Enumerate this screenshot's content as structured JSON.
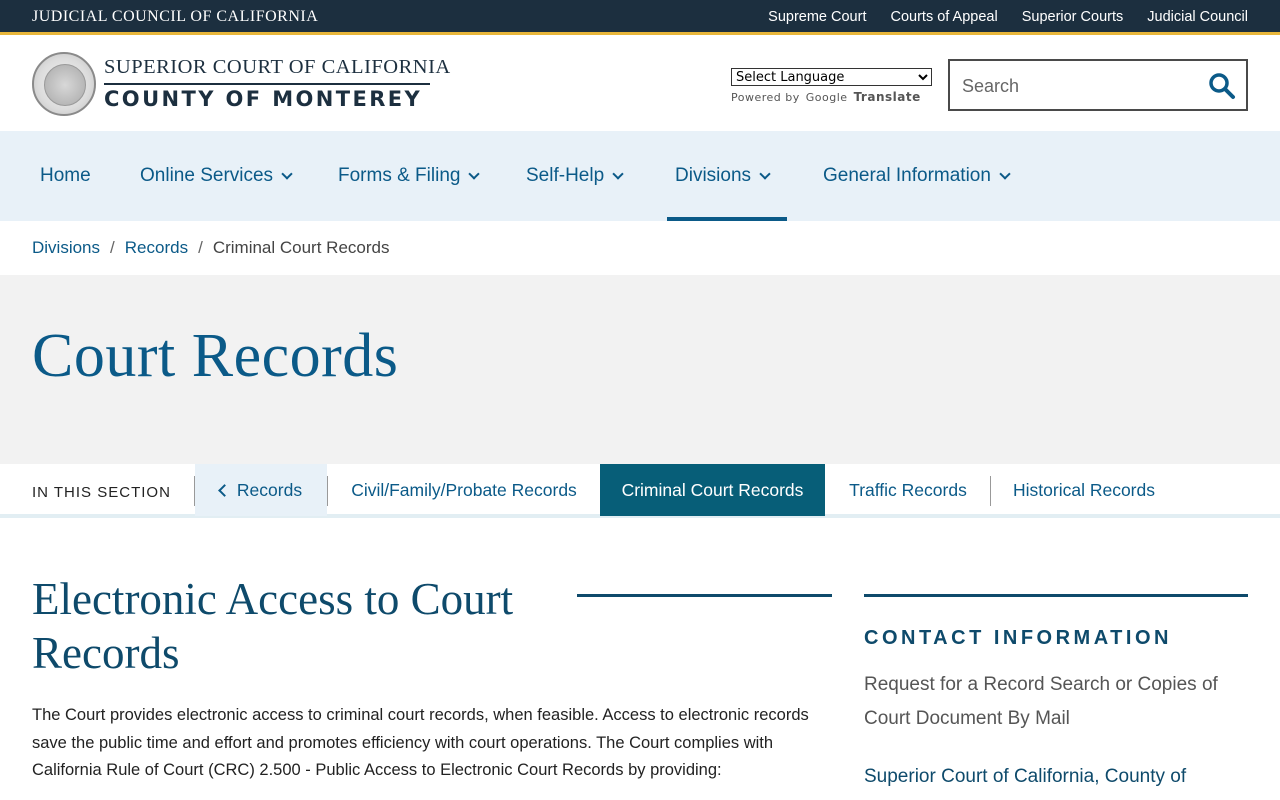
{
  "topbar": {
    "title": "JUDICIAL COUNCIL OF CALIFORNIA",
    "links": [
      "Supreme Court",
      "Courts of Appeal",
      "Superior Courts",
      "Judicial Council"
    ]
  },
  "header": {
    "line1": "SUPERIOR COURT OF CALIFORNIA",
    "line2": "COUNTY OF MONTEREY",
    "language_select": "Select Language",
    "powered_by": "Powered by",
    "google": "Google",
    "translate": "Translate",
    "search_placeholder": "Search"
  },
  "nav": {
    "items": [
      "Home",
      "Online Services",
      "Forms & Filing",
      "Self-Help",
      "Divisions",
      "General Information"
    ],
    "active": "Divisions"
  },
  "breadcrumb": {
    "items": [
      "Divisions",
      "Records"
    ],
    "current": "Criminal Court Records"
  },
  "hero": {
    "title": "Court Records"
  },
  "section_nav": {
    "label": "IN THIS SECTION",
    "back": "Records",
    "tabs": [
      "Civil/Family/Probate Records",
      "Criminal Court Records",
      "Traffic Records",
      "Historical Records"
    ],
    "active": "Criminal Court Records"
  },
  "main": {
    "title": "Electronic Access to Court Records",
    "body": "The Court provides electronic access to criminal court records, when feasible. Access to electronic records save the public time and effort and promotes efficiency with court operations. The Court complies with California Rule of Court (CRC) 2.500 - Public Access to Electronic Court Records by providing:"
  },
  "sidebar": {
    "title": "CONTACT INFORMATION",
    "link": "Request for a Record Search or Copies of Court Document By Mail",
    "text": "Superior Court of California, County of"
  },
  "colors": {
    "topbar": "#1c2f3f",
    "accent": "#e8b63a",
    "link": "#0b5a88",
    "active_tab": "#075e78"
  }
}
